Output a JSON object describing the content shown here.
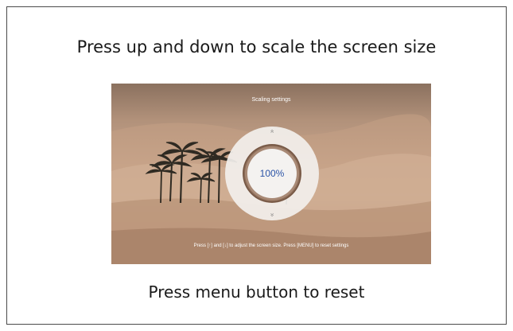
{
  "page": {
    "heading": "Press up and down to scale the screen size",
    "footer": "Press menu button to reset"
  },
  "screen": {
    "title": "Scaling settings",
    "scale_value": "100%",
    "up_arrow_glyph": "«",
    "down_arrow_glyph": "»",
    "hint": "Press [↑] and [↓] to adjust the screen size. Press [MENU] to reset settings"
  },
  "colors": {
    "value_text": "#2b54a7",
    "ring": "#f2efec",
    "ring_inner": "#8a6a55",
    "frame_border": "#4a4a4a"
  },
  "icons": {
    "up": "double-chevron-up-icon",
    "down": "double-chevron-down-icon"
  }
}
